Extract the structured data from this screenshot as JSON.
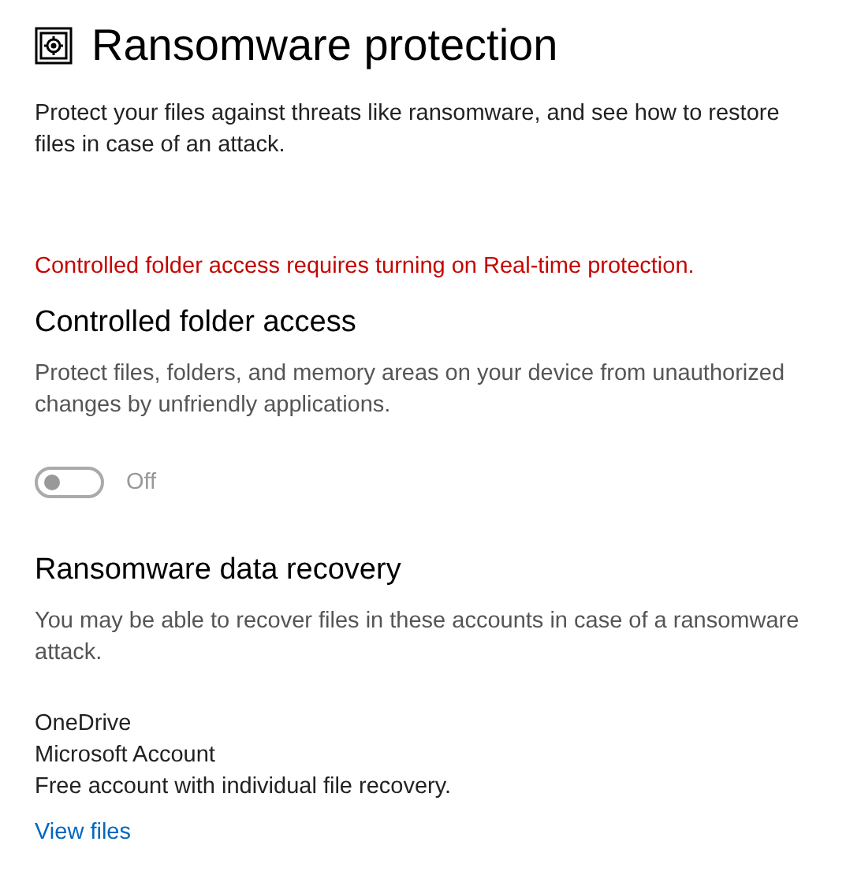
{
  "page": {
    "title": "Ransomware protection",
    "description": "Protect your files against threats like ransomware, and see how to restore files in case of an attack."
  },
  "warning": "Controlled folder access requires turning on Real-time protection.",
  "controlled_folder_access": {
    "heading": "Controlled folder access",
    "description": "Protect files, folders, and memory areas on your device from unauthorized changes by unfriendly applications.",
    "toggle": {
      "on": false,
      "disabled": true,
      "label": "Off"
    }
  },
  "data_recovery": {
    "heading": "Ransomware data recovery",
    "description": "You may be able to recover files in these accounts in case of a ransomware attack.",
    "account": {
      "name": "OneDrive",
      "type": "Microsoft Account",
      "plan": "Free account with individual file recovery."
    },
    "link": "View files"
  }
}
